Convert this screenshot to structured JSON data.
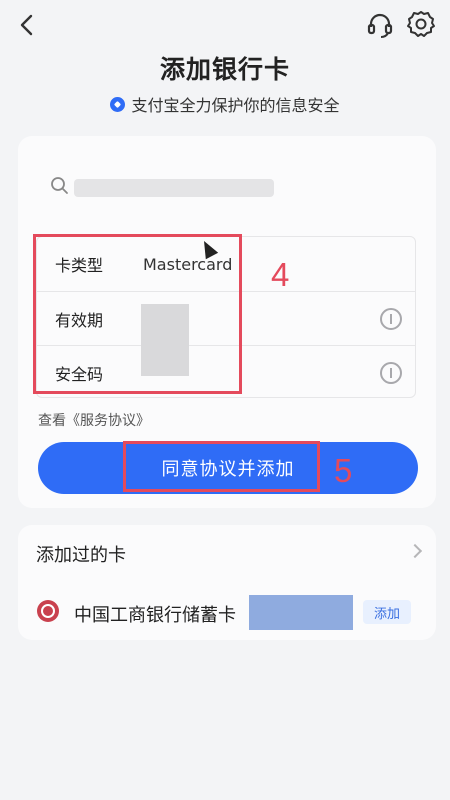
{
  "header": {
    "title": "添加银行卡",
    "subtitle": "支付宝全力保护你的信息安全"
  },
  "form": {
    "rows": [
      {
        "label": "卡类型",
        "value": "Mastercard"
      },
      {
        "label": "有效期",
        "value": ""
      },
      {
        "label": "安全码",
        "value": ""
      }
    ]
  },
  "terms_text": "查看《服务协议》",
  "agree_label": "同意协议并添加",
  "annotations": {
    "box4": "4",
    "box5": "5"
  },
  "added_cards": {
    "title": "添加过的卡",
    "items": [
      {
        "bank": "中国工商银行储蓄卡",
        "action": "添加"
      }
    ]
  },
  "colors": {
    "accent": "#2f6cf6",
    "annotation": "#e44a5c",
    "bank_logo": "#c9414e"
  },
  "icons": [
    "back-arrow-icon",
    "headset-icon",
    "gear-icon",
    "shield-icon",
    "search-icon",
    "info-icon",
    "chevron-right-icon",
    "bank-logo-icon"
  ]
}
